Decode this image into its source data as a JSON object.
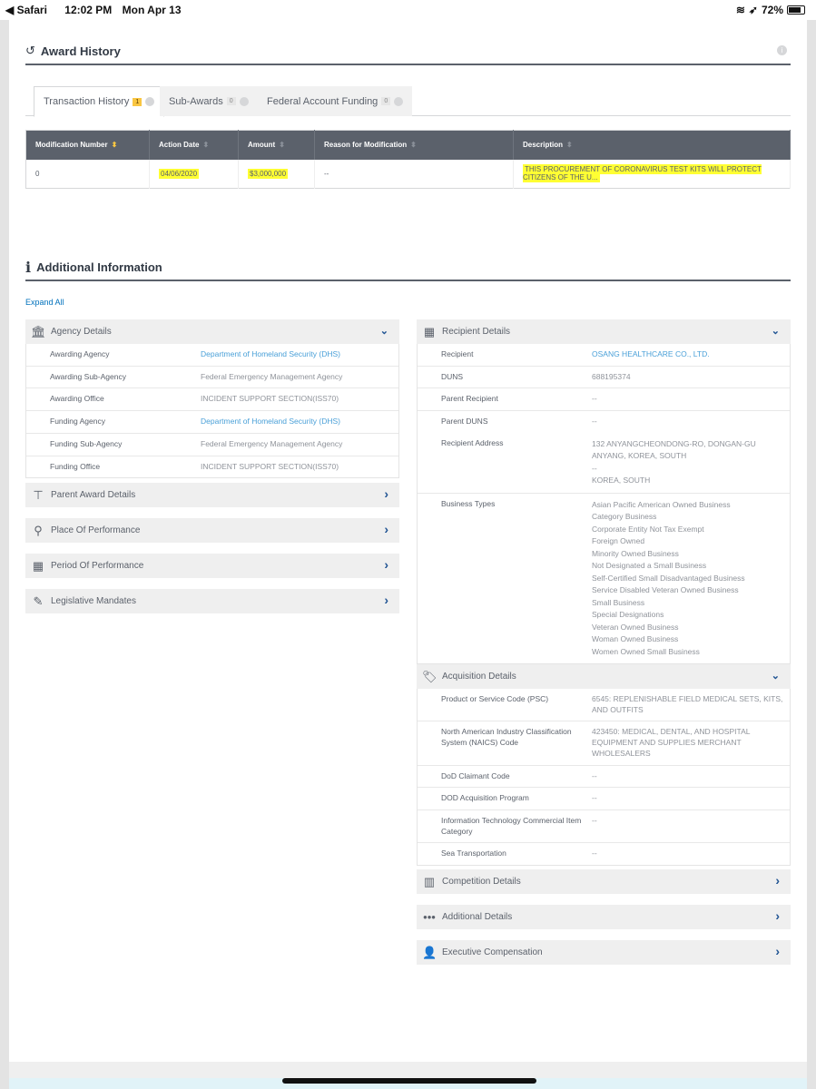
{
  "status_bar": {
    "back_app": "Safari",
    "time": "12:02 PM",
    "date": "Mon Apr 13",
    "battery": "72%"
  },
  "award_history": {
    "title": "Award History",
    "tabs": [
      {
        "label": "Transaction History",
        "count": "1"
      },
      {
        "label": "Sub-Awards",
        "count": "0"
      },
      {
        "label": "Federal Account Funding",
        "count": "0"
      }
    ],
    "table": {
      "headers": [
        "Modification Number",
        "Action Date",
        "Amount",
        "Reason for Modification",
        "Description"
      ],
      "rows": [
        [
          "0",
          "04/06/2020",
          "$3,000,000",
          "--",
          "THIS PROCUREMENT OF CORONAVIRUS TEST KITS WILL PROTECT CITIZENS OF THE U..."
        ]
      ]
    }
  },
  "additional_information": {
    "title": "Additional Information",
    "expand_all": "Expand All",
    "agency_details": {
      "title": "Agency Details",
      "rows": [
        {
          "label": "Awarding Agency",
          "value": "Department of Homeland Security (DHS)"
        },
        {
          "label": "Awarding Sub-Agency",
          "value": "Federal Emergency Management Agency"
        },
        {
          "label": "Awarding Office",
          "value": "INCIDENT SUPPORT SECTION(ISS70)"
        },
        {
          "label": "Funding Agency",
          "value": "Department of Homeland Security (DHS)"
        },
        {
          "label": "Funding Sub-Agency",
          "value": "Federal Emergency Management Agency"
        },
        {
          "label": "Funding Office",
          "value": "INCIDENT SUPPORT SECTION(ISS70)"
        }
      ]
    },
    "collapsed_left": [
      "Parent Award Details",
      "Place Of Performance",
      "Period Of Performance",
      "Legislative Mandates"
    ],
    "recipient_details": {
      "title": "Recipient Details",
      "rows": [
        {
          "label": "Recipient",
          "value": "OSANG HEALTHCARE CO., LTD."
        },
        {
          "label": "DUNS",
          "value": "688195374"
        },
        {
          "label": "Parent Recipient",
          "value": "--"
        },
        {
          "label": "Parent DUNS",
          "value": "--"
        }
      ],
      "address_label": "Recipient Address",
      "address_lines": [
        "132 ANYANGCHEONDONG-RO, DONGAN-GU",
        "ANYANG, KOREA, SOUTH",
        "--",
        "KOREA, SOUTH"
      ],
      "business_types_label": "Business Types",
      "business_types": [
        "Asian Pacific American Owned Business",
        "Category Business",
        "Corporate Entity Not Tax Exempt",
        "Foreign Owned",
        "Minority Owned Business",
        "Not Designated a Small Business",
        "Self-Certified Small Disadvantaged Business",
        "Service Disabled Veteran Owned Business",
        "Small Business",
        "Special Designations",
        "Veteran Owned Business",
        "Woman Owned Business",
        "Women Owned Small Business"
      ]
    },
    "acquisition_details": {
      "title": "Acquisition Details",
      "rows": [
        {
          "label": "Product or Service Code (PSC)",
          "value": "6545: REPLENISHABLE FIELD MEDICAL SETS, KITS, AND OUTFITS"
        },
        {
          "label": "North American Industry Classification System (NAICS) Code",
          "value": "423450: MEDICAL, DENTAL, AND HOSPITAL EQUIPMENT AND SUPPLIES MERCHANT WHOLESALERS"
        },
        {
          "label": "DoD Claimant Code",
          "value": "--"
        },
        {
          "label": "DOD Acquisition Program",
          "value": "--"
        },
        {
          "label": "Information Technology Commercial Item Category",
          "value": "--"
        },
        {
          "label": "Sea Transportation",
          "value": "--"
        }
      ]
    },
    "collapsed_right": [
      "Competition Details",
      "Additional Details",
      "Executive Compensation"
    ]
  }
}
